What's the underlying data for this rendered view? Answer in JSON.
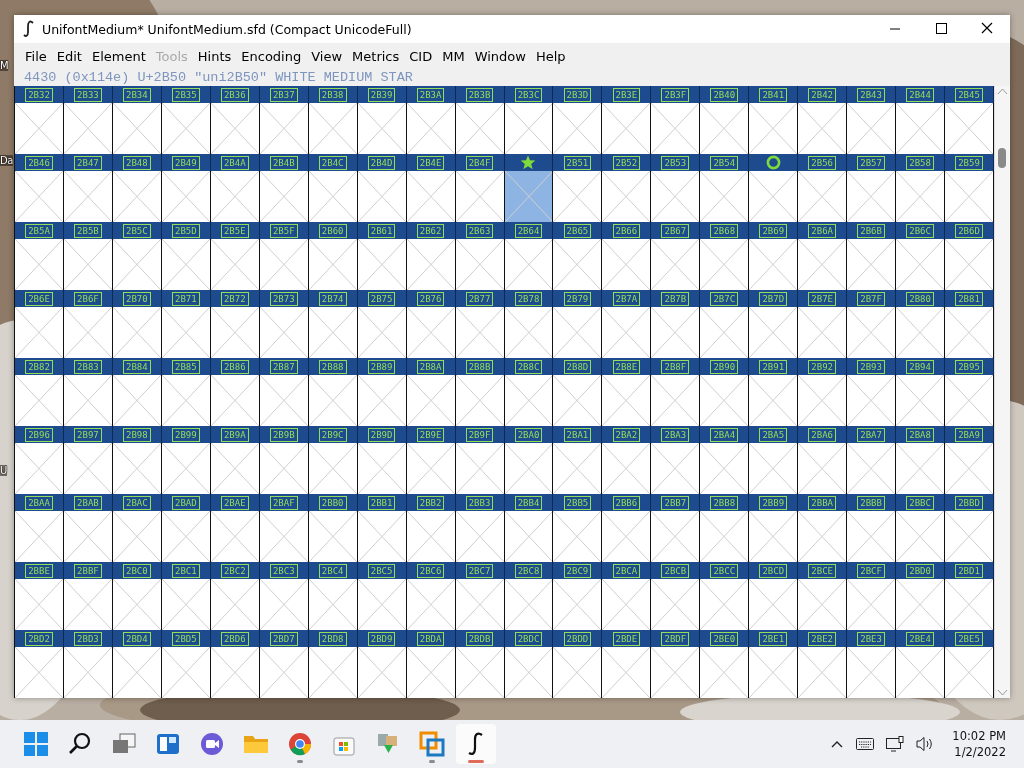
{
  "desktop": {
    "labels": [
      "M",
      "Da",
      "U"
    ]
  },
  "window": {
    "title": "UnifontMedium*  UnifontMedium.sfd (Compact UnicodeFull)"
  },
  "menu": [
    {
      "label": "File",
      "disabled": false
    },
    {
      "label": "Edit",
      "disabled": false
    },
    {
      "label": "Element",
      "disabled": false
    },
    {
      "label": "Tools",
      "disabled": true
    },
    {
      "label": "Hints",
      "disabled": false
    },
    {
      "label": "Encoding",
      "disabled": false
    },
    {
      "label": "View",
      "disabled": false
    },
    {
      "label": "Metrics",
      "disabled": false
    },
    {
      "label": "CID",
      "disabled": false
    },
    {
      "label": "MM",
      "disabled": false
    },
    {
      "label": "Window",
      "disabled": false
    },
    {
      "label": "Help",
      "disabled": false
    }
  ],
  "status_line": "4430 (0x114e) U+2B50 \"uni2B50\" WHITE MEDIUM STAR",
  "grid": {
    "rows": [
      {
        "cells": [
          {
            "kind": "code",
            "label": "2B32",
            "selected": false
          },
          {
            "kind": "code",
            "label": "2B33",
            "selected": false
          },
          {
            "kind": "code",
            "label": "2B34",
            "selected": false
          },
          {
            "kind": "code",
            "label": "2B35",
            "selected": false
          },
          {
            "kind": "code",
            "label": "2B36",
            "selected": false
          },
          {
            "kind": "code",
            "label": "2B37",
            "selected": false
          },
          {
            "kind": "code",
            "label": "2B38",
            "selected": false
          },
          {
            "kind": "code",
            "label": "2B39",
            "selected": false
          },
          {
            "kind": "code",
            "label": "2B3A",
            "selected": false
          },
          {
            "kind": "code",
            "label": "2B3B",
            "selected": false
          },
          {
            "kind": "code",
            "label": "2B3C",
            "selected": false
          },
          {
            "kind": "code",
            "label": "2B3D",
            "selected": false
          },
          {
            "kind": "code",
            "label": "2B3E",
            "selected": false
          },
          {
            "kind": "code",
            "label": "2B3F",
            "selected": false
          },
          {
            "kind": "code",
            "label": "2B40",
            "selected": false
          },
          {
            "kind": "code",
            "label": "2B41",
            "selected": false
          },
          {
            "kind": "code",
            "label": "2B42",
            "selected": false
          },
          {
            "kind": "code",
            "label": "2B43",
            "selected": false
          },
          {
            "kind": "code",
            "label": "2B44",
            "selected": false
          },
          {
            "kind": "code",
            "label": "2B45",
            "selected": false
          }
        ]
      },
      {
        "cells": [
          {
            "kind": "code",
            "label": "2B46",
            "selected": false
          },
          {
            "kind": "code",
            "label": "2B47",
            "selected": false
          },
          {
            "kind": "code",
            "label": "2B48",
            "selected": false
          },
          {
            "kind": "code",
            "label": "2B49",
            "selected": false
          },
          {
            "kind": "code",
            "label": "2B4A",
            "selected": false
          },
          {
            "kind": "code",
            "label": "2B4B",
            "selected": false
          },
          {
            "kind": "code",
            "label": "2B4C",
            "selected": false
          },
          {
            "kind": "code",
            "label": "2B4D",
            "selected": false
          },
          {
            "kind": "code",
            "label": "2B4E",
            "selected": false
          },
          {
            "kind": "code",
            "label": "2B4F",
            "selected": false
          },
          {
            "kind": "star",
            "selected": true
          },
          {
            "kind": "code",
            "label": "2B51",
            "selected": false
          },
          {
            "kind": "code",
            "label": "2B52",
            "selected": false
          },
          {
            "kind": "code",
            "label": "2B53",
            "selected": false
          },
          {
            "kind": "code",
            "label": "2B54",
            "selected": false
          },
          {
            "kind": "ring",
            "selected": false
          },
          {
            "kind": "code",
            "label": "2B56",
            "selected": false
          },
          {
            "kind": "code",
            "label": "2B57",
            "selected": false
          },
          {
            "kind": "code",
            "label": "2B58",
            "selected": false
          },
          {
            "kind": "code",
            "label": "2B59",
            "selected": false
          }
        ]
      },
      {
        "cells": [
          {
            "kind": "code",
            "label": "2B5A",
            "selected": false
          },
          {
            "kind": "code",
            "label": "2B5B",
            "selected": false
          },
          {
            "kind": "code",
            "label": "2B5C",
            "selected": false
          },
          {
            "kind": "code",
            "label": "2B5D",
            "selected": false
          },
          {
            "kind": "code",
            "label": "2B5E",
            "selected": false
          },
          {
            "kind": "code",
            "label": "2B5F",
            "selected": false
          },
          {
            "kind": "code",
            "label": "2B60",
            "selected": false
          },
          {
            "kind": "code",
            "label": "2B61",
            "selected": false
          },
          {
            "kind": "code",
            "label": "2B62",
            "selected": false
          },
          {
            "kind": "code",
            "label": "2B63",
            "selected": false
          },
          {
            "kind": "code",
            "label": "2B64",
            "selected": false
          },
          {
            "kind": "code",
            "label": "2B65",
            "selected": false
          },
          {
            "kind": "code",
            "label": "2B66",
            "selected": false
          },
          {
            "kind": "code",
            "label": "2B67",
            "selected": false
          },
          {
            "kind": "code",
            "label": "2B68",
            "selected": false
          },
          {
            "kind": "code",
            "label": "2B69",
            "selected": false
          },
          {
            "kind": "code",
            "label": "2B6A",
            "selected": false
          },
          {
            "kind": "code",
            "label": "2B6B",
            "selected": false
          },
          {
            "kind": "code",
            "label": "2B6C",
            "selected": false
          },
          {
            "kind": "code",
            "label": "2B6D",
            "selected": false
          }
        ]
      },
      {
        "cells": [
          {
            "kind": "code",
            "label": "2B6E",
            "selected": false
          },
          {
            "kind": "code",
            "label": "2B6F",
            "selected": false
          },
          {
            "kind": "code",
            "label": "2B70",
            "selected": false
          },
          {
            "kind": "code",
            "label": "2B71",
            "selected": false
          },
          {
            "kind": "code",
            "label": "2B72",
            "selected": false
          },
          {
            "kind": "code",
            "label": "2B73",
            "selected": false
          },
          {
            "kind": "code",
            "label": "2B74",
            "selected": false
          },
          {
            "kind": "code",
            "label": "2B75",
            "selected": false
          },
          {
            "kind": "code",
            "label": "2B76",
            "selected": false
          },
          {
            "kind": "code",
            "label": "2B77",
            "selected": false
          },
          {
            "kind": "code",
            "label": "2B78",
            "selected": false
          },
          {
            "kind": "code",
            "label": "2B79",
            "selected": false
          },
          {
            "kind": "code",
            "label": "2B7A",
            "selected": false
          },
          {
            "kind": "code",
            "label": "2B7B",
            "selected": false
          },
          {
            "kind": "code",
            "label": "2B7C",
            "selected": false
          },
          {
            "kind": "code",
            "label": "2B7D",
            "selected": false
          },
          {
            "kind": "code",
            "label": "2B7E",
            "selected": false
          },
          {
            "kind": "code",
            "label": "2B7F",
            "selected": false
          },
          {
            "kind": "code",
            "label": "2B80",
            "selected": false
          },
          {
            "kind": "code",
            "label": "2B81",
            "selected": false
          }
        ]
      },
      {
        "cells": [
          {
            "kind": "code",
            "label": "2B82",
            "selected": false
          },
          {
            "kind": "code",
            "label": "2B83",
            "selected": false
          },
          {
            "kind": "code",
            "label": "2B84",
            "selected": false
          },
          {
            "kind": "code",
            "label": "2B85",
            "selected": false
          },
          {
            "kind": "code",
            "label": "2B86",
            "selected": false
          },
          {
            "kind": "code",
            "label": "2B87",
            "selected": false
          },
          {
            "kind": "code",
            "label": "2B88",
            "selected": false
          },
          {
            "kind": "code",
            "label": "2B89",
            "selected": false
          },
          {
            "kind": "code",
            "label": "2B8A",
            "selected": false
          },
          {
            "kind": "code",
            "label": "2B8B",
            "selected": false
          },
          {
            "kind": "code",
            "label": "2B8C",
            "selected": false
          },
          {
            "kind": "code",
            "label": "2B8D",
            "selected": false
          },
          {
            "kind": "code",
            "label": "2B8E",
            "selected": false
          },
          {
            "kind": "code",
            "label": "2B8F",
            "selected": false
          },
          {
            "kind": "code",
            "label": "2B90",
            "selected": false
          },
          {
            "kind": "code",
            "label": "2B91",
            "selected": false
          },
          {
            "kind": "code",
            "label": "2B92",
            "selected": false
          },
          {
            "kind": "code",
            "label": "2B93",
            "selected": false
          },
          {
            "kind": "code",
            "label": "2B94",
            "selected": false
          },
          {
            "kind": "code",
            "label": "2B95",
            "selected": false
          }
        ]
      },
      {
        "cells": [
          {
            "kind": "code",
            "label": "2B96",
            "selected": false
          },
          {
            "kind": "code",
            "label": "2B97",
            "selected": false
          },
          {
            "kind": "code",
            "label": "2B98",
            "selected": false
          },
          {
            "kind": "code",
            "label": "2B99",
            "selected": false
          },
          {
            "kind": "code",
            "label": "2B9A",
            "selected": false
          },
          {
            "kind": "code",
            "label": "2B9B",
            "selected": false
          },
          {
            "kind": "code",
            "label": "2B9C",
            "selected": false
          },
          {
            "kind": "code",
            "label": "2B9D",
            "selected": false
          },
          {
            "kind": "code",
            "label": "2B9E",
            "selected": false
          },
          {
            "kind": "code",
            "label": "2B9F",
            "selected": false
          },
          {
            "kind": "code",
            "label": "2BA0",
            "selected": false
          },
          {
            "kind": "code",
            "label": "2BA1",
            "selected": false
          },
          {
            "kind": "code",
            "label": "2BA2",
            "selected": false
          },
          {
            "kind": "code",
            "label": "2BA3",
            "selected": false
          },
          {
            "kind": "code",
            "label": "2BA4",
            "selected": false
          },
          {
            "kind": "code",
            "label": "2BA5",
            "selected": false
          },
          {
            "kind": "code",
            "label": "2BA6",
            "selected": false
          },
          {
            "kind": "code",
            "label": "2BA7",
            "selected": false
          },
          {
            "kind": "code",
            "label": "2BA8",
            "selected": false
          },
          {
            "kind": "code",
            "label": "2BA9",
            "selected": false
          }
        ]
      },
      {
        "cells": [
          {
            "kind": "code",
            "label": "2BAA",
            "selected": false
          },
          {
            "kind": "code",
            "label": "2BAB",
            "selected": false
          },
          {
            "kind": "code",
            "label": "2BAC",
            "selected": false
          },
          {
            "kind": "code",
            "label": "2BAD",
            "selected": false
          },
          {
            "kind": "code",
            "label": "2BAE",
            "selected": false
          },
          {
            "kind": "code",
            "label": "2BAF",
            "selected": false
          },
          {
            "kind": "code",
            "label": "2BB0",
            "selected": false
          },
          {
            "kind": "code",
            "label": "2BB1",
            "selected": false
          },
          {
            "kind": "code",
            "label": "2BB2",
            "selected": false
          },
          {
            "kind": "code",
            "label": "2BB3",
            "selected": false
          },
          {
            "kind": "code",
            "label": "2BB4",
            "selected": false
          },
          {
            "kind": "code",
            "label": "2BB5",
            "selected": false
          },
          {
            "kind": "code",
            "label": "2BB6",
            "selected": false
          },
          {
            "kind": "code",
            "label": "2BB7",
            "selected": false
          },
          {
            "kind": "code",
            "label": "2BB8",
            "selected": false
          },
          {
            "kind": "code",
            "label": "2BB9",
            "selected": false
          },
          {
            "kind": "code",
            "label": "2BBA",
            "selected": false
          },
          {
            "kind": "code",
            "label": "2BBB",
            "selected": false
          },
          {
            "kind": "code",
            "label": "2BBC",
            "selected": false
          },
          {
            "kind": "code",
            "label": "2BBD",
            "selected": false
          }
        ]
      },
      {
        "cells": [
          {
            "kind": "code",
            "label": "2BBE",
            "selected": false
          },
          {
            "kind": "code",
            "label": "2BBF",
            "selected": false
          },
          {
            "kind": "code",
            "label": "2BC0",
            "selected": false
          },
          {
            "kind": "code",
            "label": "2BC1",
            "selected": false
          },
          {
            "kind": "code",
            "label": "2BC2",
            "selected": false
          },
          {
            "kind": "code",
            "label": "2BC3",
            "selected": false
          },
          {
            "kind": "code",
            "label": "2BC4",
            "selected": false
          },
          {
            "kind": "code",
            "label": "2BC5",
            "selected": false
          },
          {
            "kind": "code",
            "label": "2BC6",
            "selected": false
          },
          {
            "kind": "code",
            "label": "2BC7",
            "selected": false
          },
          {
            "kind": "code",
            "label": "2BC8",
            "selected": false
          },
          {
            "kind": "code",
            "label": "2BC9",
            "selected": false
          },
          {
            "kind": "code",
            "label": "2BCA",
            "selected": false
          },
          {
            "kind": "code",
            "label": "2BCB",
            "selected": false
          },
          {
            "kind": "code",
            "label": "2BCC",
            "selected": false
          },
          {
            "kind": "code",
            "label": "2BCD",
            "selected": false
          },
          {
            "kind": "code",
            "label": "2BCE",
            "selected": false
          },
          {
            "kind": "code",
            "label": "2BCF",
            "selected": false
          },
          {
            "kind": "code",
            "label": "2BD0",
            "selected": false
          },
          {
            "kind": "code",
            "label": "2BD1",
            "selected": false
          }
        ]
      },
      {
        "cells": [
          {
            "kind": "code",
            "label": "2BD2",
            "selected": false
          },
          {
            "kind": "code",
            "label": "2BD3",
            "selected": false
          },
          {
            "kind": "code",
            "label": "2BD4",
            "selected": false
          },
          {
            "kind": "code",
            "label": "2BD5",
            "selected": false
          },
          {
            "kind": "code",
            "label": "2BD6",
            "selected": false
          },
          {
            "kind": "code",
            "label": "2BD7",
            "selected": false
          },
          {
            "kind": "code",
            "label": "2BD8",
            "selected": false
          },
          {
            "kind": "code",
            "label": "2BD9",
            "selected": false
          },
          {
            "kind": "code",
            "label": "2BDA",
            "selected": false
          },
          {
            "kind": "code",
            "label": "2BDB",
            "selected": false
          },
          {
            "kind": "code",
            "label": "2BDC",
            "selected": false
          },
          {
            "kind": "code",
            "label": "2BDD",
            "selected": false
          },
          {
            "kind": "code",
            "label": "2BDE",
            "selected": false
          },
          {
            "kind": "code",
            "label": "2BDF",
            "selected": false
          },
          {
            "kind": "code",
            "label": "2BE0",
            "selected": false
          },
          {
            "kind": "code",
            "label": "2BE1",
            "selected": false
          },
          {
            "kind": "code",
            "label": "2BE2",
            "selected": false
          },
          {
            "kind": "code",
            "label": "2BE3",
            "selected": false
          },
          {
            "kind": "code",
            "label": "2BE4",
            "selected": false
          },
          {
            "kind": "code",
            "label": "2BE5",
            "selected": false
          }
        ]
      }
    ]
  },
  "taskbar": {
    "apps": [
      {
        "kind": "start",
        "selected": false,
        "running": false
      },
      {
        "kind": "search",
        "selected": false,
        "running": false
      },
      {
        "kind": "taskview",
        "selected": false,
        "running": false
      },
      {
        "kind": "widgets",
        "selected": false,
        "running": false
      },
      {
        "kind": "chat",
        "selected": false,
        "running": false
      },
      {
        "kind": "folder",
        "selected": false,
        "running": false
      },
      {
        "kind": "browser",
        "selected": false,
        "running": true
      },
      {
        "kind": "store",
        "selected": false,
        "running": false
      },
      {
        "kind": "download",
        "selected": false,
        "running": false
      },
      {
        "kind": "squares",
        "selected": false,
        "running": true
      },
      {
        "kind": "curve",
        "selected": true,
        "running": true
      }
    ],
    "clock": {
      "time": "10:02 PM",
      "date": "1/2/2022"
    }
  }
}
